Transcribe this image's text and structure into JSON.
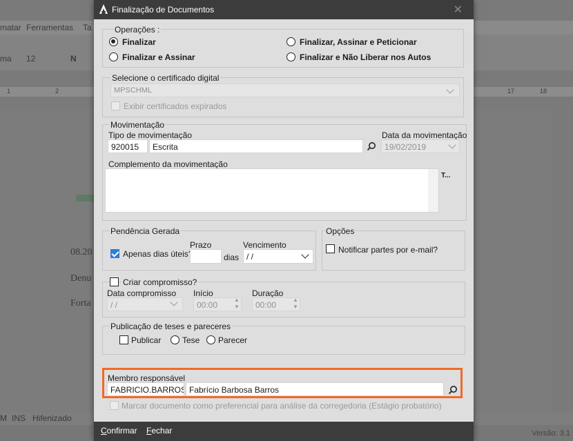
{
  "background": {
    "menu": [
      "matar",
      "Ferramentas",
      "Ta"
    ],
    "font_name": "ma",
    "font_size": "12",
    "ruler_ticks": [
      "1",
      "2",
      "17",
      "18"
    ],
    "doc_lines": [
      "08.20",
      "Denu",
      "Forta"
    ],
    "status_items": [
      "M",
      "INS",
      "Hifenizado"
    ],
    "version": "Versão: 3.1"
  },
  "dialog": {
    "title": "Finalização de Documentos",
    "operacoes": {
      "label": "Operações :",
      "options": [
        "Finalizar",
        "Finalizar e Assinar",
        "Finalizar, Assinar e Peticionar",
        "Finalizar e Não Liberar nos Autos"
      ],
      "selected": "Finalizar"
    },
    "certificado": {
      "label": "Selecione o certificado digital",
      "value": "MPSCHML",
      "expired_label": "Exibir certificados expirados"
    },
    "movimentacao": {
      "label": "Movimentação",
      "tipo_label": "Tipo de movimentação",
      "tipo_code": "920015",
      "tipo_desc": "Escrita",
      "data_label": "Data da movimentação",
      "data_value": "19/02/2019",
      "complemento_label": "Complemento da movimentação",
      "side_text": "T..."
    },
    "pendencia": {
      "label": "Pendência Gerada",
      "apenas_label": "Apenas dias úteis?",
      "prazo_label": "Prazo",
      "dias_label": "dias",
      "vencimento_label": "Vencimento",
      "vencimento_value": " /  /"
    },
    "opcoes": {
      "label": "Opções",
      "notificar_label": "Notificar partes por e-mail?"
    },
    "compromisso": {
      "label": "Criar compromisso?",
      "data_label": "Data compromisso",
      "data_value": " /  /",
      "inicio_label": "Início",
      "inicio_value": "00:00",
      "duracao_label": "Duração",
      "duracao_value": "00:00"
    },
    "publicacao": {
      "label": "Publicação de teses e pareceres",
      "publicar_label": "Publicar",
      "tese_label": "Tese",
      "parecer_label": "Parecer"
    },
    "membro": {
      "label": "Membro responsável",
      "code": "FABRICIO.BARROS",
      "name": "Fabrício Barbosa Barros"
    },
    "marcar_label": "Marcar documento como preferencial para análise da corregedoria (Estágio probatório)",
    "buttons": {
      "confirmar": "Confirmar",
      "fechar": "Fechar"
    }
  },
  "colors": {
    "highlight": "#f06a28",
    "titlebar": "#3c3c3c",
    "check_on": "#2f7dd6"
  }
}
